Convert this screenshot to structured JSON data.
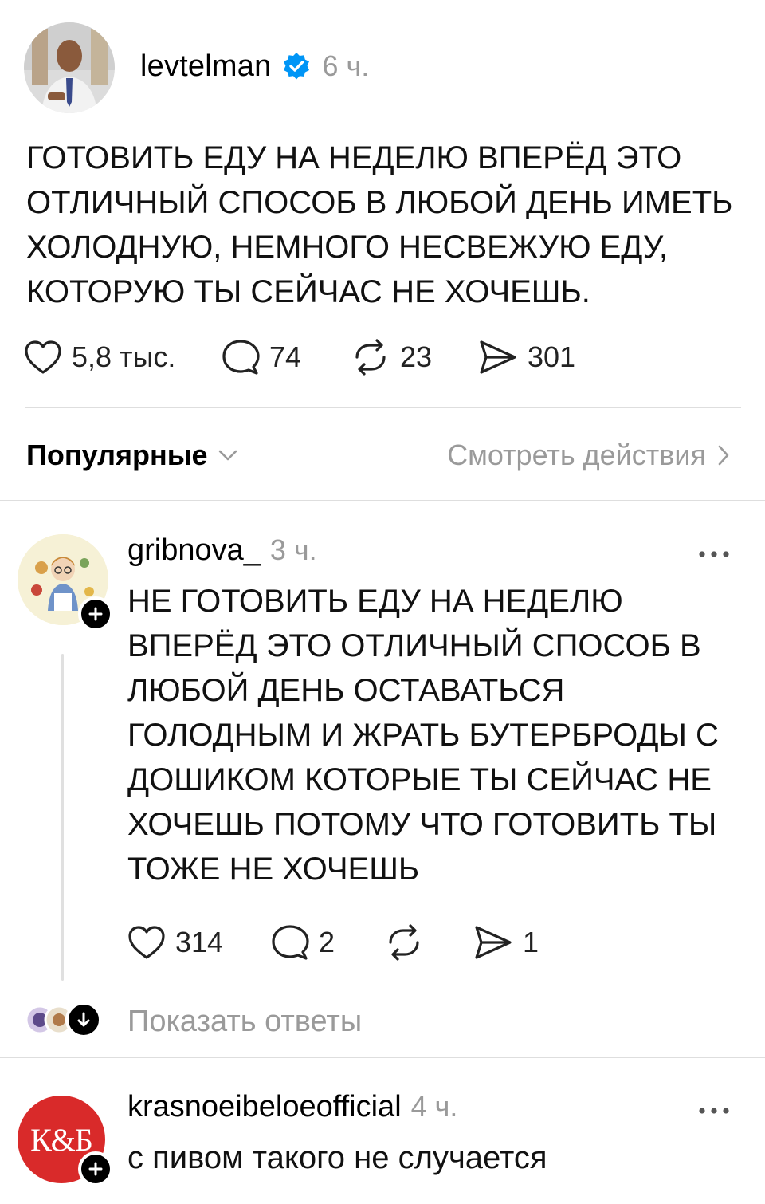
{
  "post": {
    "username": "levtelman",
    "time": "6 ч.",
    "text": "ГОТОВИТЬ ЕДУ НА НЕДЕЛЮ ВПЕРЁД ЭТО ОТЛИЧНЫЙ СПОСОБ В ЛЮБОЙ ДЕНЬ ИМЕТЬ ХОЛОДНУЮ, НЕМНОГО НЕСВЕЖУЮ ЕДУ, КОТОРУЮ ТЫ СЕЙЧАС НЕ ХОЧЕШЬ.",
    "likes": "5,8 тыс.",
    "comments": "74",
    "reposts": "23",
    "shares": "301",
    "verified_color": "#0095f6"
  },
  "sort": {
    "label": "Популярные",
    "activity_label": "Смотреть действия"
  },
  "replies": [
    {
      "username": "gribnova_",
      "time": "3 ч.",
      "text": "НЕ ГОТОВИТЬ ЕДУ НА НЕДЕЛЮ ВПЕРЁД ЭТО ОТЛИЧНЫЙ СПОСОБ В ЛЮБОЙ ДЕНЬ ОСТАВАТЬСЯ ГОЛОДНЫМ И ЖРАТЬ БУТЕРБРОДЫ С ДОШИКОМ КОТОРЫЕ ТЫ СЕЙЧАС НЕ ХОЧЕШЬ ПОТОМУ ЧТО ГОТОВИТЬ ТЫ ТОЖЕ НЕ ХОЧЕШЬ",
      "likes": "314",
      "comments": "2",
      "shares": "1",
      "show_replies": "Показать ответы"
    },
    {
      "username": "krasnoeibeloeofficial",
      "time": "4 ч.",
      "text": "с пивом такого не случается",
      "avatar_text": "К&Б",
      "avatar_color": "#d92a2a"
    }
  ],
  "icons": {
    "more": "more-icon",
    "like": "heart-icon",
    "comment": "comment-icon",
    "repost": "repost-icon",
    "share": "send-icon"
  }
}
